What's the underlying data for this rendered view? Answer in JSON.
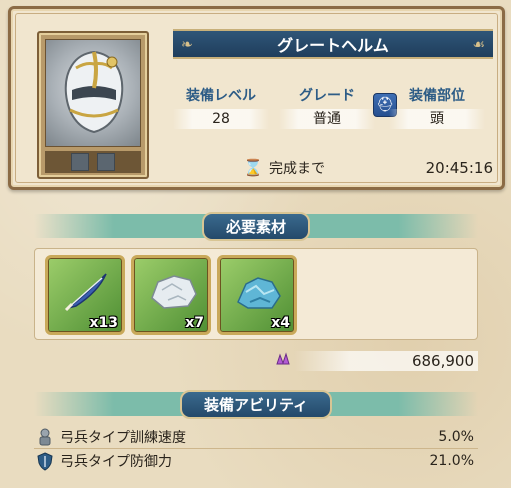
{
  "item": {
    "name": "グレートヘルム",
    "icon": "helmet-art",
    "stats": {
      "level_label": "装備レベル",
      "level_value": "28",
      "grade_label": "グレード",
      "grade_value": "普通",
      "slot_label": "装備部位",
      "slot_value": "頭",
      "slot_icon": "helmet-icon"
    },
    "timer": {
      "icon": "hourglass-icon",
      "label": "完成まで",
      "value": "20:45:16"
    }
  },
  "materials_section": {
    "title": "必要素材",
    "items": [
      {
        "icon": "feather-icon",
        "quantity": "x13"
      },
      {
        "icon": "stone-icon",
        "quantity": "x7"
      },
      {
        "icon": "crystal-ore-icon",
        "quantity": "x4"
      }
    ],
    "cost": {
      "icon": "purple-crystal-icon",
      "value": "686,900"
    }
  },
  "ability_section": {
    "title": "装備アビリティ",
    "items": [
      {
        "icon": "archer-icon",
        "label": "弓兵タイプ訓練速度",
        "value": "5.0%"
      },
      {
        "icon": "shield-icon",
        "label": "弓兵タイプ防御力",
        "value": "21.0%"
      }
    ]
  },
  "colors": {
    "banner_blue": "#1f3e5c",
    "label_blue": "#2d5c86",
    "section_teal": "#7cbcaa",
    "parchment": "#f1e6cf"
  }
}
